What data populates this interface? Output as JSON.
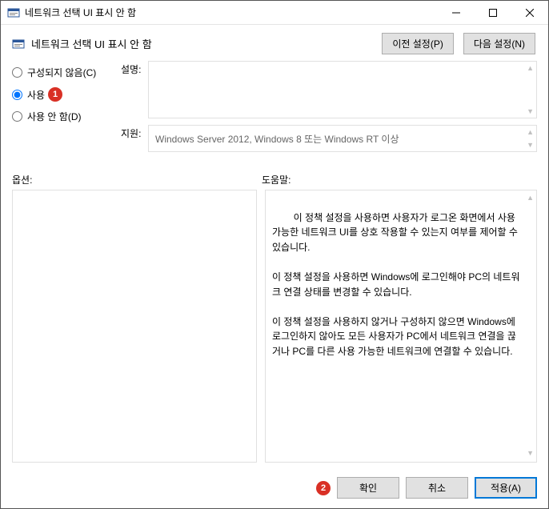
{
  "window": {
    "title": "네트워크 선택 UI 표시 안 함"
  },
  "header": {
    "title": "네트워크 선택 UI 표시 안 함",
    "prev_label": "이전 설정(P)",
    "next_label": "다음 설정(N)"
  },
  "radios": {
    "not_configured": "구성되지 않음(C)",
    "enabled": "사용",
    "disabled": "사용 안 함(D)",
    "selected": "enabled"
  },
  "annotations": {
    "badge1": "1",
    "badge2": "2"
  },
  "fields": {
    "description_label": "설명:",
    "description_value": "",
    "support_label": "지원:",
    "support_value": "Windows Server 2012, Windows 8 또는 Windows RT 이상"
  },
  "sections": {
    "options_label": "옵션:",
    "help_label": "도움말:"
  },
  "help_text": "이 정책 설정을 사용하면 사용자가 로그온 화면에서 사용 가능한 네트워크 UI를 상호 작용할 수 있는지 여부를 제어할 수 있습니다.\n\n이 정책 설정을 사용하면 Windows에 로그인해야 PC의 네트워크 연결 상태를 변경할 수 있습니다.\n\n이 정책 설정을 사용하지 않거나 구성하지 않으면 Windows에 로그인하지 않아도 모든 사용자가 PC에서 네트워크 연결을 끊거나 PC를 다른 사용 가능한 네트워크에 연결할 수 있습니다.",
  "footer": {
    "ok": "확인",
    "cancel": "취소",
    "apply": "적용(A)"
  }
}
